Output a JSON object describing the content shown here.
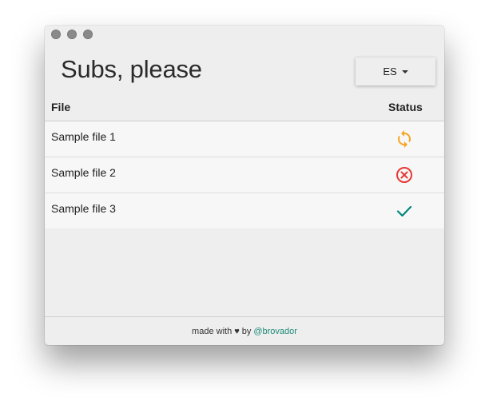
{
  "window": {
    "title": "Subs, please"
  },
  "language_selector": {
    "value": "ES"
  },
  "table": {
    "headers": {
      "file": "File",
      "status": "Status"
    },
    "rows": [
      {
        "file": "Sample file 1",
        "status_icon": "sync-icon",
        "status_color": "#f5a623"
      },
      {
        "file": "Sample file 2",
        "status_icon": "error-icon",
        "status_color": "#e53935"
      },
      {
        "file": "Sample file 3",
        "status_icon": "check-icon",
        "status_color": "#00897b"
      }
    ]
  },
  "footer": {
    "text": "made with",
    "heart": "♥",
    "by": "by",
    "link": "@brovador",
    "link_color": "#1e8a7a"
  }
}
